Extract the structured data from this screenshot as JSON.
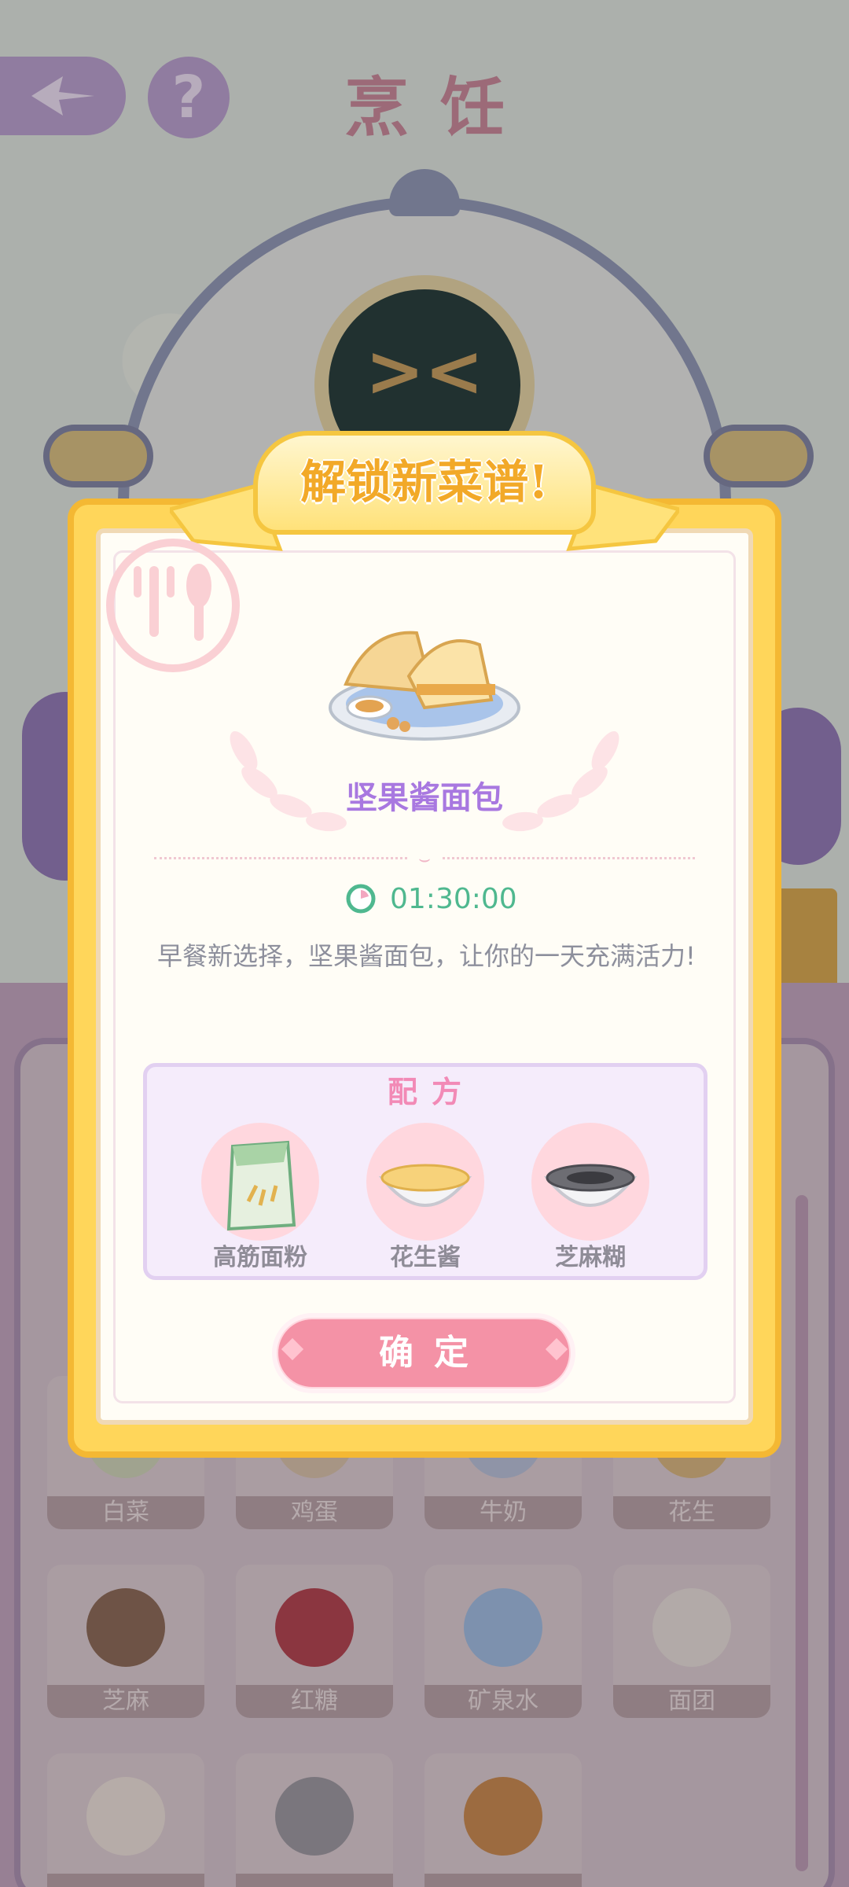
{
  "header": {
    "title": "烹饪",
    "back_icon": "compass-arrow-icon",
    "help_label": "?"
  },
  "background_items": [
    {
      "label": "白菜"
    },
    {
      "label": "鸡蛋"
    },
    {
      "label": "牛奶"
    },
    {
      "label": "花生"
    },
    {
      "label": "芝麻"
    },
    {
      "label": "红糖"
    },
    {
      "label": "矿泉水"
    },
    {
      "label": "面团"
    },
    {
      "label": ""
    },
    {
      "label": ""
    },
    {
      "label": ""
    }
  ],
  "dialog": {
    "banner": "解锁新菜谱!",
    "dish_name": "坚果酱面包",
    "timer": "01:30:00",
    "description": "早餐新选择，坚果酱面包，让你的一天充满活力!",
    "recipe_title": "配方",
    "ingredients": [
      {
        "name": "高筋面粉",
        "icon": "flour-bag-icon"
      },
      {
        "name": "花生酱",
        "icon": "peanut-butter-bowl-icon"
      },
      {
        "name": "芝麻糊",
        "icon": "sesame-paste-bowl-icon"
      }
    ],
    "confirm_label": "确定"
  },
  "colors": {
    "frame_yellow": "#ffd65a",
    "dish_name_purple": "#a878e0",
    "timer_green": "#4fb88f",
    "confirm_pink": "#f492a6",
    "recipe_title_pink": "#f28ab6"
  }
}
